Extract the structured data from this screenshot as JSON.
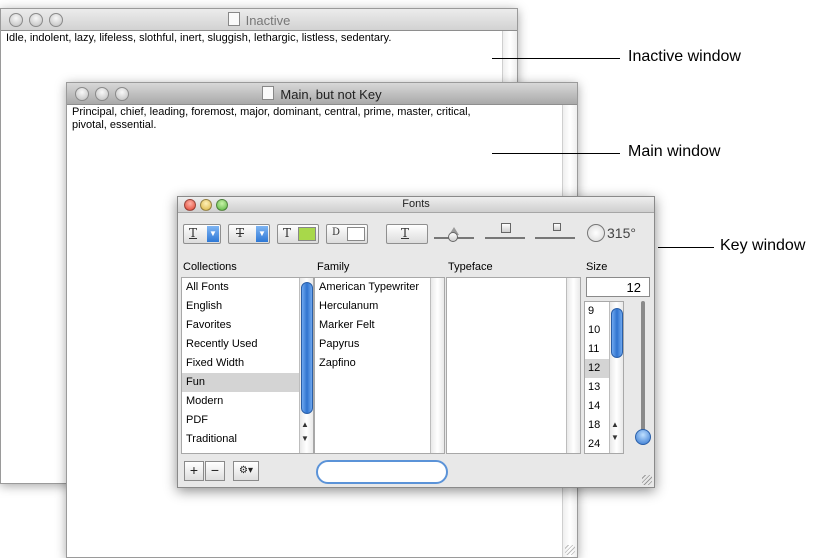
{
  "windows": {
    "inactive": {
      "title": "Inactive",
      "text": "Idle, indolent, lazy, lifeless, slothful, inert, sluggish, lethargic, listless, sedentary."
    },
    "main": {
      "title": "Main, but not Key",
      "text_line1": "Principal, chief, leading, foremost, major, dominant, central, prime, master, critical,",
      "text_line2": "pivotal, essential."
    }
  },
  "callouts": {
    "inactive": "Inactive window",
    "main": "Main window",
    "key": "Key window"
  },
  "fonts_panel": {
    "title": "Fonts",
    "toolbar": {
      "underline_glyph": "T",
      "strike_glyph": "T",
      "text_color_glyph": "T",
      "doc_color_glyph": "D",
      "shadow_glyph": "T",
      "angle": "315°",
      "text_color": "#a8d84a",
      "doc_color": "#ffffff"
    },
    "headers": {
      "collections": "Collections",
      "family": "Family",
      "typeface": "Typeface",
      "size": "Size"
    },
    "collections": [
      "All Fonts",
      "English",
      "Favorites",
      "Recently Used",
      "Fixed Width",
      "Fun",
      "Modern",
      "PDF",
      "Traditional"
    ],
    "selected_collection": "Fun",
    "families": [
      "American Typewriter",
      "Herculanum",
      "Marker Felt",
      "Papyrus",
      "Zapfino"
    ],
    "size_value": "12",
    "sizes": [
      "9",
      "10",
      "11",
      "12",
      "13",
      "14",
      "18",
      "24"
    ],
    "selected_size": "12",
    "bottom": {
      "add": "+",
      "remove": "−",
      "gear": "⚙▾"
    }
  }
}
